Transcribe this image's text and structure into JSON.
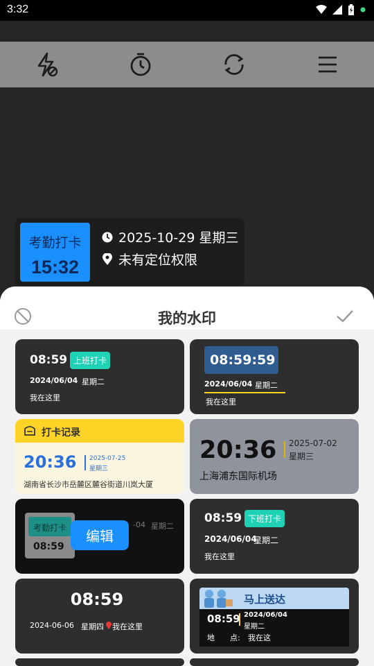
{
  "status": {
    "time": "3:32"
  },
  "toolbar": {
    "items": [
      {
        "icon": "flash-off-icon"
      },
      {
        "icon": "timer-icon"
      },
      {
        "icon": "switch-camera-icon"
      },
      {
        "icon": "menu-icon"
      }
    ]
  },
  "watermark": {
    "title": "考勤打卡",
    "time": "15:32",
    "date": "2025-10-29 星期三",
    "location": "未有定位权限"
  },
  "sheet": {
    "title": "我的水印"
  },
  "tiles": {
    "t1": {
      "time": "08:59",
      "tag": "上班打卡",
      "date": "2024/06/04",
      "weekday": "星期二",
      "place": "我在这里"
    },
    "t2": {
      "time": "08:59:59",
      "date": "2024/06/04",
      "weekday": "星期二",
      "place": "我在这里"
    },
    "t3": {
      "header": "打卡记录",
      "time": "20:36",
      "date": "2025-07-25",
      "weekday": "星期三",
      "address": "湖南省长沙市岳麓区麓谷街道川岚大厦"
    },
    "t4": {
      "time": "20:36",
      "date": "2025-07-02",
      "weekday": "星期三",
      "place": "上海浦东国际机场"
    },
    "t5": {
      "title": "考勤打卡",
      "time": "08:59",
      "date_frag": "-04",
      "weekday": "星期二",
      "edit": "编辑"
    },
    "t6": {
      "time": "08:59",
      "tag": "下班打卡",
      "date": "2024/06/04",
      "weekday": "星期二",
      "place": "我在这里"
    },
    "t7": {
      "time": "08:59",
      "date": "2024-06-06",
      "weekday": "星期四",
      "place": "我在这里"
    },
    "t8": {
      "banner": "马上送达",
      "time": "08:59",
      "date": "2024/06/04",
      "weekday": "星期二",
      "loc_label": "地　　点:",
      "loc_value": "我在这"
    }
  },
  "colors": {
    "accent_blue": "#1a90ff",
    "green_tag": "#1fd1b5",
    "yellow": "#ffd426"
  }
}
